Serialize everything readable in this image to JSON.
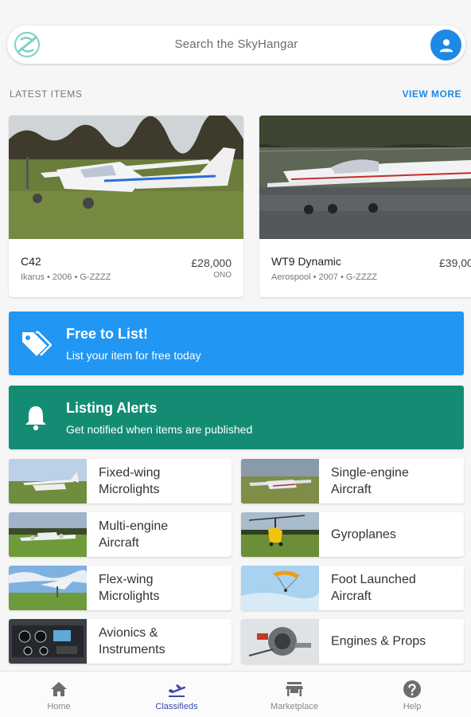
{
  "search": {
    "placeholder": "Search the SkyHangar"
  },
  "latest": {
    "title": "LATEST ITEMS",
    "view_more": "VIEW MORE",
    "items": [
      {
        "name": "C42",
        "meta": "Ikarus • 2006 • G-ZZZZ",
        "price": "£28,000",
        "note": "ONO"
      },
      {
        "name": "WT9 Dynamic",
        "meta": "Aerospool • 2007 • G-ZZZZ",
        "price": "£39,00",
        "note": ""
      }
    ]
  },
  "banners": {
    "free": {
      "title": "Free to List!",
      "subtitle": "List your item for free today",
      "color": "#2196f3"
    },
    "alerts": {
      "title": "Listing Alerts",
      "subtitle": "Get notified when items are published",
      "color": "#148c74"
    }
  },
  "categories": [
    {
      "label": "Fixed-wing\nMicrolights"
    },
    {
      "label": "Single-engine\nAircraft"
    },
    {
      "label": "Multi-engine\nAircraft"
    },
    {
      "label": "Gyroplanes"
    },
    {
      "label": "Flex-wing\nMicrolights"
    },
    {
      "label": "Foot Launched\nAircraft"
    },
    {
      "label": "Avionics &\nInstruments"
    },
    {
      "label": "Engines & Props"
    }
  ],
  "nav": {
    "items": [
      {
        "label": "Home",
        "icon": "home-icon"
      },
      {
        "label": "Classifieds",
        "icon": "airplane-takeoff-icon"
      },
      {
        "label": "Marketplace",
        "icon": "store-icon"
      },
      {
        "label": "Help",
        "icon": "help-icon"
      }
    ],
    "active": "Classifieds",
    "active_color": "#3949ab"
  },
  "colors": {
    "accent": "#1e88e5"
  }
}
